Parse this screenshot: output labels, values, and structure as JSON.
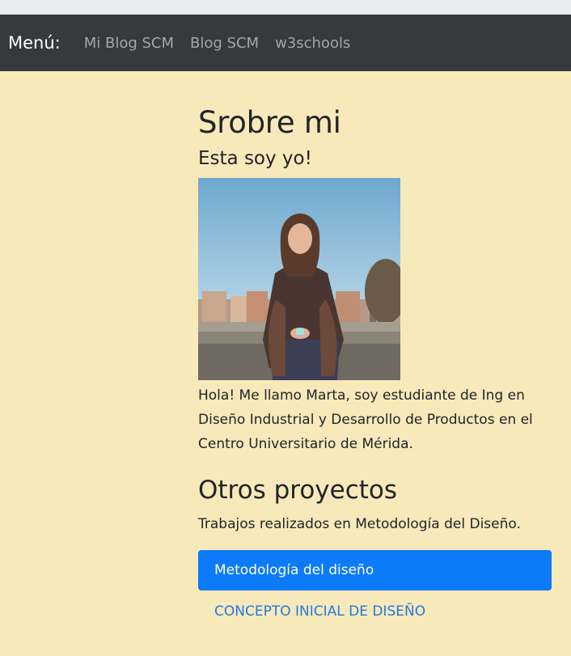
{
  "navbar": {
    "brand": "Menú:",
    "links": [
      "Mi Blog SCM",
      "Blog SCM",
      "w3schools"
    ]
  },
  "about": {
    "title": "Srobre mi",
    "subtitle": "Esta soy yo!",
    "bio": "Hola! Me llamo Marta, soy estudiante de Ing en Diseño Industrial y Desarrollo de Productos en el Centro Universitario de Mérida."
  },
  "projects": {
    "title": "Otros proyectos",
    "description": "Trabajos realizados en Metodología del Diseño.",
    "items": [
      "Metodología del diseño",
      "CONCEPTO INICIAL DE DISEÑO"
    ]
  },
  "colors": {
    "page_background": "#f7e9ba",
    "navbar": "#343a40",
    "accent": "#0d7bf8",
    "link": "#1f7ae0"
  }
}
